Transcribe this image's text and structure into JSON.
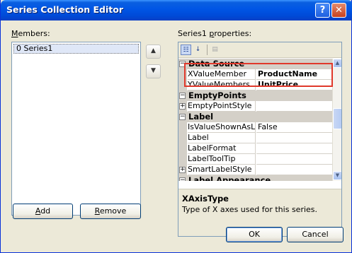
{
  "window": {
    "title": "Series Collection Editor",
    "help_glyph": "?",
    "close_glyph": "✕"
  },
  "members": {
    "label_pre": "",
    "label_ul": "M",
    "label_post": "embers:",
    "items": [
      {
        "index": "0",
        "name": "Series1"
      }
    ],
    "move_up_glyph": "▲",
    "move_down_glyph": "▼"
  },
  "buttons": {
    "add_ul": "A",
    "add_rest": "dd",
    "remove_ul": "R",
    "remove_rest": "emove",
    "ok": "OK",
    "cancel": "Cancel"
  },
  "properties": {
    "label_pre": "Series1 ",
    "label_ul": "p",
    "label_post": "roperties:",
    "toolbar": {
      "categorized_icon": "categorized-icon",
      "alphabetical_icon": "alphabetical-icon",
      "pages_icon": "property-pages-icon"
    },
    "rows": [
      {
        "type": "cat",
        "glyph": "⊟",
        "name": "Data Source"
      },
      {
        "type": "prop",
        "name": "XValueMember",
        "value": "ProductName",
        "bold": true
      },
      {
        "type": "prop",
        "name": "YValueMembers",
        "value": "UnitPrice",
        "bold": true
      },
      {
        "type": "cat",
        "glyph": "⊟",
        "name": "EmptyPoints"
      },
      {
        "type": "prop",
        "expander": "⊞",
        "name": "EmptyPointStyle",
        "value": ""
      },
      {
        "type": "cat",
        "glyph": "⊟",
        "name": "Label"
      },
      {
        "type": "prop",
        "name": "IsValueShownAsLabel",
        "value": "False"
      },
      {
        "type": "prop",
        "name": "Label",
        "value": ""
      },
      {
        "type": "prop",
        "name": "LabelFormat",
        "value": ""
      },
      {
        "type": "prop",
        "name": "LabelToolTip",
        "value": ""
      },
      {
        "type": "prop",
        "expander": "⊞",
        "name": "SmartLabelStyle",
        "value": ""
      },
      {
        "type": "cat",
        "glyph": "⊟",
        "name": "Label Appearance"
      }
    ],
    "description": {
      "title": "XAxisType",
      "text": "Type of X axes used for this series."
    }
  },
  "colors": {
    "titlebar": "#0055e5",
    "dialog_bg": "#ece9d8",
    "highlight": "#e0382b"
  }
}
